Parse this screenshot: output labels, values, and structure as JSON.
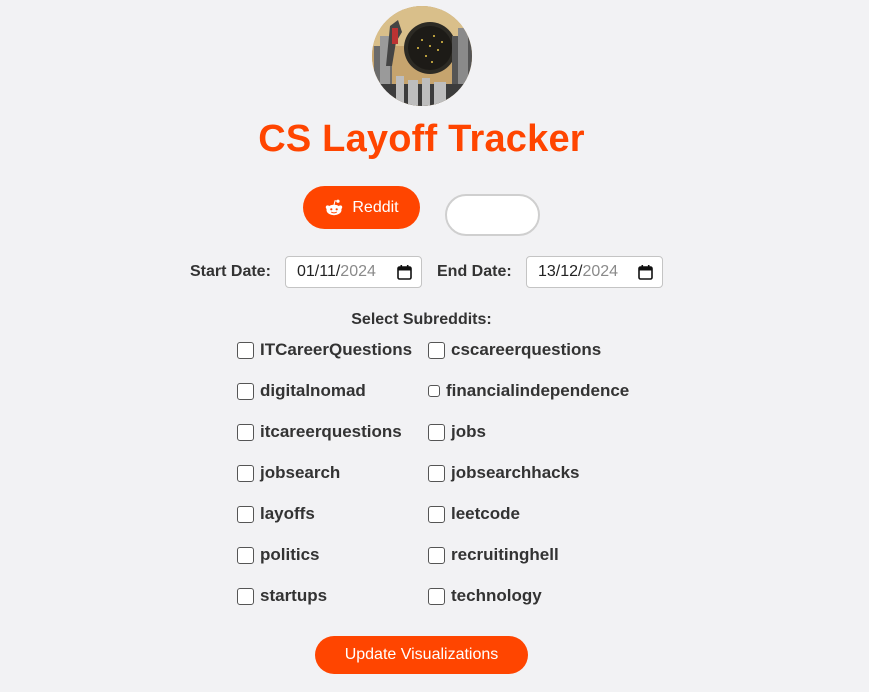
{
  "header": {
    "logo_icon": "cityscape-avatar-icon",
    "title": "CS Layoff Tracker"
  },
  "source_buttons": {
    "reddit_label": "Reddit",
    "reddit_icon": "reddit-icon",
    "second_label": ""
  },
  "date_range": {
    "start_label": "Start Date:",
    "start_value_dm": "01/11/",
    "start_value_year": "2024",
    "end_label": "End Date:",
    "end_value_dm": "13/12/",
    "end_value_year": "2024",
    "picker_icon": "calendar-icon"
  },
  "subreddits": {
    "heading": "Select Subreddits:",
    "items": [
      {
        "label": "ITCareerQuestions",
        "checked": false
      },
      {
        "label": "cscareerquestions",
        "checked": false
      },
      {
        "label": "digitalnomad",
        "checked": false
      },
      {
        "label": "financialindependence",
        "checked": false
      },
      {
        "label": "itcareerquestions",
        "checked": false
      },
      {
        "label": "jobs",
        "checked": false
      },
      {
        "label": "jobsearch",
        "checked": false
      },
      {
        "label": "jobsearchhacks",
        "checked": false
      },
      {
        "label": "layoffs",
        "checked": false
      },
      {
        "label": "leetcode",
        "checked": false
      },
      {
        "label": "politics",
        "checked": false
      },
      {
        "label": "recruitinghell",
        "checked": false
      },
      {
        "label": "startups",
        "checked": false
      },
      {
        "label": "technology",
        "checked": false
      }
    ]
  },
  "actions": {
    "update_label": "Update Visualizations"
  },
  "colors": {
    "accent": "#ff4500",
    "background": "#f2f2f4",
    "text": "#333333"
  }
}
